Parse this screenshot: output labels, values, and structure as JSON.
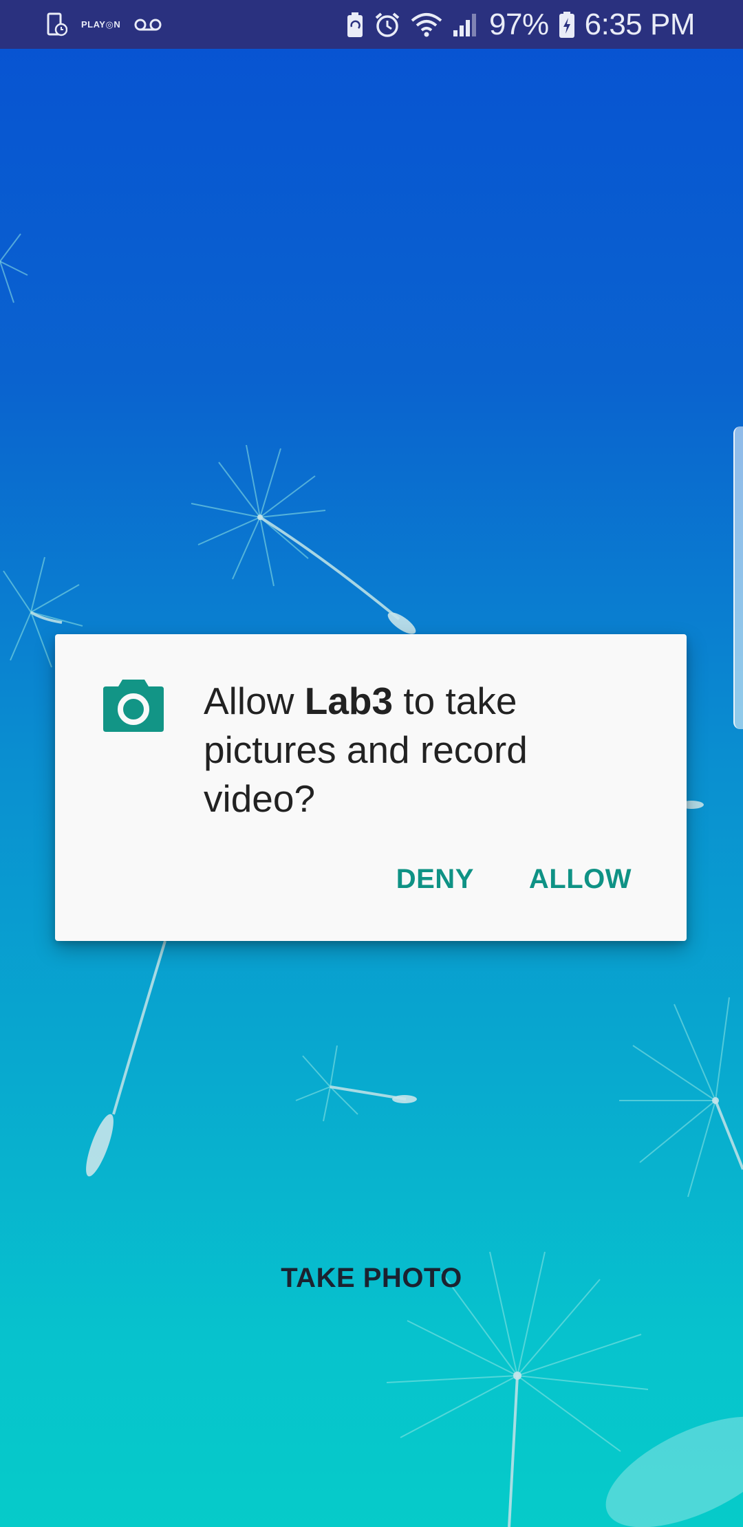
{
  "status_bar": {
    "left_icons": [
      "screen-timer-icon",
      "playon-icon",
      "voicemail-icon"
    ],
    "playon_label": "PLAYON",
    "right_icons": [
      "battery-saver-icon",
      "alarm-icon",
      "wifi-icon",
      "signal-icon",
      "battery-charging-icon"
    ],
    "battery_percent": "97%",
    "time": "6:35 PM"
  },
  "dialog": {
    "icon": "camera-icon",
    "message_prefix": "Allow ",
    "app_name": "Lab3",
    "message_suffix": " to take pictures and record video?",
    "deny_label": "DENY",
    "allow_label": "ALLOW"
  },
  "main": {
    "take_photo_label": "TAKE PHOTO"
  },
  "colors": {
    "status_bar": "#2a317f",
    "dialog_button": "#0f9285",
    "camera_icon": "#129586"
  }
}
